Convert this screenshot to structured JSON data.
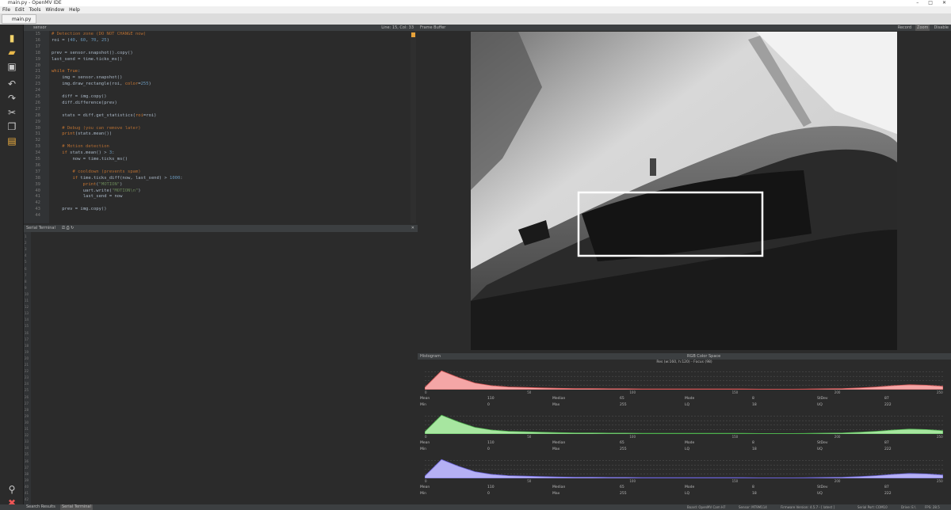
{
  "window": {
    "title": "main.py - OpenMV IDE"
  },
  "menu": [
    "File",
    "Edit",
    "Tools",
    "Window",
    "Help"
  ],
  "file_tab": "main.py",
  "toolbar_icons": [
    "new-file-icon",
    "open-folder-icon",
    "save-icon",
    "undo-icon",
    "redo-icon",
    "cut-icon",
    "copy-icon",
    "paste-icon",
    "connect-icon",
    "stop-icon"
  ],
  "editor": {
    "header_left": "sensor",
    "header_right": "Line: 15, Col: 33",
    "lines": [
      {
        "n": "15",
        "segs": [
          {
            "c": "cm",
            "t": "# Detection zone (DO NOT CHANGE now)"
          }
        ]
      },
      {
        "n": "16",
        "segs": [
          {
            "c": "",
            "t": "roi = ("
          },
          {
            "c": "nm",
            "t": "40"
          },
          {
            "c": "",
            "t": ", "
          },
          {
            "c": "nm",
            "t": "60"
          },
          {
            "c": "",
            "t": ", "
          },
          {
            "c": "nm",
            "t": "70"
          },
          {
            "c": "",
            "t": ", "
          },
          {
            "c": "nm",
            "t": "25"
          },
          {
            "c": "",
            "t": ")"
          }
        ]
      },
      {
        "n": "17",
        "segs": []
      },
      {
        "n": "18",
        "segs": [
          {
            "c": "",
            "t": "prev = sensor.snapshot().copy()"
          }
        ]
      },
      {
        "n": "19",
        "segs": [
          {
            "c": "",
            "t": "last_send = time.ticks_ms()"
          }
        ]
      },
      {
        "n": "20",
        "segs": []
      },
      {
        "n": "21",
        "segs": [
          {
            "c": "kw",
            "t": "while True"
          },
          {
            "c": "",
            "t": ":"
          }
        ]
      },
      {
        "n": "22",
        "segs": [
          {
            "c": "",
            "t": "    img = sensor.snapshot()"
          }
        ]
      },
      {
        "n": "23",
        "segs": [
          {
            "c": "",
            "t": "    img.draw_rectangle(roi, "
          },
          {
            "c": "kw",
            "t": "color"
          },
          {
            "c": "",
            "t": "="
          },
          {
            "c": "nm",
            "t": "255"
          },
          {
            "c": "",
            "t": ")"
          }
        ]
      },
      {
        "n": "24",
        "segs": []
      },
      {
        "n": "25",
        "segs": [
          {
            "c": "",
            "t": "    diff = img.copy()"
          }
        ]
      },
      {
        "n": "26",
        "segs": [
          {
            "c": "",
            "t": "    diff.difference(prev)"
          }
        ]
      },
      {
        "n": "27",
        "segs": []
      },
      {
        "n": "28",
        "segs": [
          {
            "c": "",
            "t": "    stats = diff.get_statistics("
          },
          {
            "c": "kw",
            "t": "roi"
          },
          {
            "c": "",
            "t": "=roi)"
          }
        ]
      },
      {
        "n": "29",
        "segs": []
      },
      {
        "n": "30",
        "segs": [
          {
            "c": "cm",
            "t": "    # Debug (you can remove later)"
          }
        ]
      },
      {
        "n": "31",
        "segs": [
          {
            "c": "kw",
            "t": "    print"
          },
          {
            "c": "",
            "t": "(stats.mean())"
          }
        ]
      },
      {
        "n": "32",
        "segs": []
      },
      {
        "n": "33",
        "segs": [
          {
            "c": "cm",
            "t": "    # Motion detection"
          }
        ]
      },
      {
        "n": "34",
        "segs": [
          {
            "c": "kw",
            "t": "    if"
          },
          {
            "c": "",
            "t": " stats.mean() > "
          },
          {
            "c": "nm",
            "t": "3"
          },
          {
            "c": "",
            "t": ":"
          }
        ]
      },
      {
        "n": "35",
        "segs": [
          {
            "c": "",
            "t": "        now = time.ticks_ms()"
          }
        ]
      },
      {
        "n": "36",
        "segs": []
      },
      {
        "n": "37",
        "segs": [
          {
            "c": "cm",
            "t": "        # cooldown (prevents spam)"
          }
        ]
      },
      {
        "n": "38",
        "segs": [
          {
            "c": "kw",
            "t": "        if"
          },
          {
            "c": "",
            "t": " time.ticks_diff(now, last_send) > "
          },
          {
            "c": "nm",
            "t": "1000"
          },
          {
            "c": "",
            "t": ":"
          }
        ]
      },
      {
        "n": "39",
        "segs": [
          {
            "c": "kw",
            "t": "            print"
          },
          {
            "c": "",
            "t": "("
          },
          {
            "c": "st",
            "t": "\"MOTION\""
          },
          {
            "c": "",
            "t": ")"
          }
        ]
      },
      {
        "n": "40",
        "segs": [
          {
            "c": "",
            "t": "            uart.write("
          },
          {
            "c": "st",
            "t": "\"MOTION\\n\""
          },
          {
            "c": "",
            "t": ")"
          }
        ]
      },
      {
        "n": "41",
        "segs": [
          {
            "c": "",
            "t": "            last_send = now"
          }
        ]
      },
      {
        "n": "42",
        "segs": []
      },
      {
        "n": "43",
        "segs": [
          {
            "c": "",
            "t": "    prev = img.copy()"
          }
        ]
      },
      {
        "n": "44",
        "segs": []
      }
    ]
  },
  "serial": {
    "title": "Serial Terminal",
    "line_count": 42
  },
  "bottom_tabs": [
    "Search Results",
    "Serial Terminal"
  ],
  "framebuffer": {
    "title": "Frame Buffer",
    "buttons": [
      "Record",
      "Zoom",
      "Disable"
    ]
  },
  "histogram": {
    "title": "Histogram",
    "color_space": "RGB Color Space",
    "subtitle": "Res (w:160, h:120) - Focus (98)",
    "x_ticks": [
      "0",
      "50",
      "100",
      "150",
      "200",
      "250"
    ],
    "channels": [
      {
        "name": "R",
        "color": "#f4a6a6",
        "line": "#d45555",
        "stats": {
          "Mean": "110",
          "Median": "65",
          "Mode": "8",
          "StDev": "87",
          "Min": "0",
          "Max": "255",
          "LQ": "18",
          "UQ": "222"
        }
      },
      {
        "name": "G",
        "color": "#a7e6a0",
        "line": "#4db04d",
        "stats": {
          "Mean": "110",
          "Median": "65",
          "Mode": "8",
          "StDev": "87",
          "Min": "0",
          "Max": "255",
          "LQ": "18",
          "UQ": "222"
        }
      },
      {
        "name": "B",
        "color": "#b5b0f4",
        "line": "#6a62d8",
        "stats": {
          "Mean": "110",
          "Median": "65",
          "Mode": "8",
          "StDev": "87",
          "Min": "0",
          "Max": "255",
          "LQ": "18",
          "UQ": "222"
        }
      }
    ]
  },
  "status": {
    "board": "Board: OpenMV Cam H7",
    "sensor": "Sensor: MT9M114",
    "firmware": "Firmware Version: 4.5.7 - [ latest ]",
    "serial_port": "Serial Port: COM10",
    "drive": "Drive: E:\\",
    "fps": "FPS: 28.5"
  }
}
